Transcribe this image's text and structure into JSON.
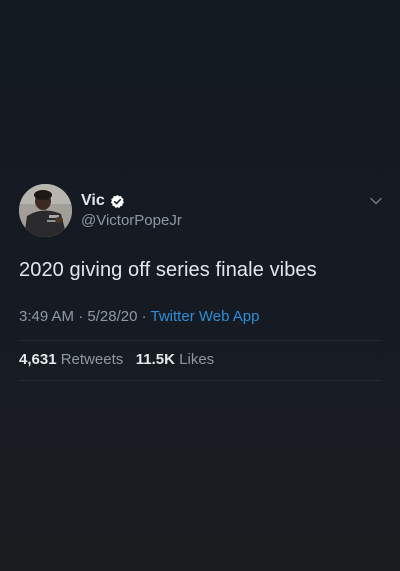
{
  "tweet": {
    "author": {
      "display_name": "Vic",
      "handle": "@VictorPopeJr",
      "verified": true
    },
    "text": "2020 giving off series finale vibes",
    "time": "3:49 AM",
    "date": "5/28/20",
    "separator": "·",
    "source": "Twitter Web App",
    "retweets_count": "4,631",
    "retweets_label": "Retweets",
    "likes_count": "11.5K",
    "likes_label": "Likes"
  },
  "colors": {
    "background": "#161b23",
    "text_primary": "#e4e7ea",
    "text_secondary": "#8e98a3",
    "link": "#2d8fd8",
    "verified_badge": "#ffffff"
  },
  "icons": {
    "verified": "verified-badge-icon",
    "caret": "chevron-down-icon"
  }
}
